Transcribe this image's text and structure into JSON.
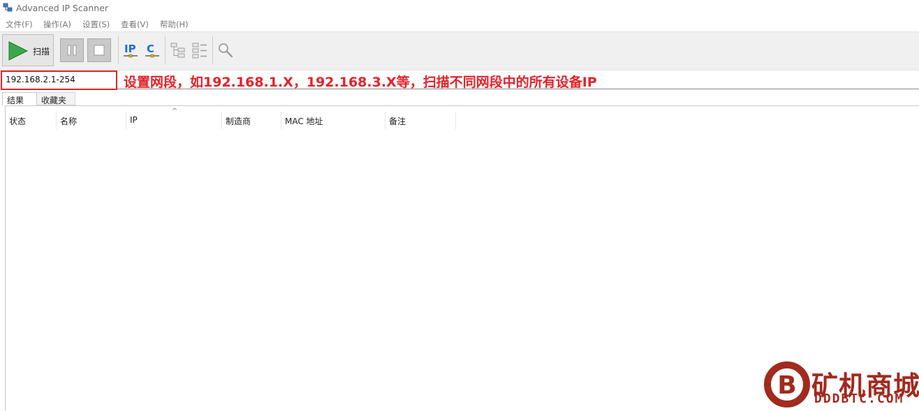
{
  "window": {
    "title": "Advanced IP Scanner",
    "app_icon": "network-computers-icon"
  },
  "menu": [
    {
      "label": "文件(F)"
    },
    {
      "label": "操作(A)"
    },
    {
      "label": "设置(S)"
    },
    {
      "label": "查看(V)"
    },
    {
      "label": "帮助(H)"
    }
  ],
  "toolbar": {
    "scan_label": "扫描",
    "ip_icon_text": "IP",
    "c_icon_text": "C"
  },
  "range_input": {
    "value": "192.168.2.1-254"
  },
  "annotation": {
    "text": "设置网段，如192.168.1.X，192.168.3.X等，扫描不同网段中的所有设备IP"
  },
  "tabs": [
    {
      "label": "结果"
    },
    {
      "label": "收藏夹"
    }
  ],
  "columns": [
    {
      "label": "状态"
    },
    {
      "label": "名称"
    },
    {
      "label": "IP"
    },
    {
      "label": "制造商"
    },
    {
      "label": "MAC 地址"
    },
    {
      "label": "备注"
    }
  ],
  "sort_indicator": "^",
  "watermark": {
    "title": "矿机商城",
    "subtitle": "DDDBTC.COM"
  },
  "colors": {
    "accent_red": "#e2232a",
    "play_green": "#3aa84a",
    "icon_blue": "#1f6fd1",
    "watermark_red": "#a22a1e"
  }
}
